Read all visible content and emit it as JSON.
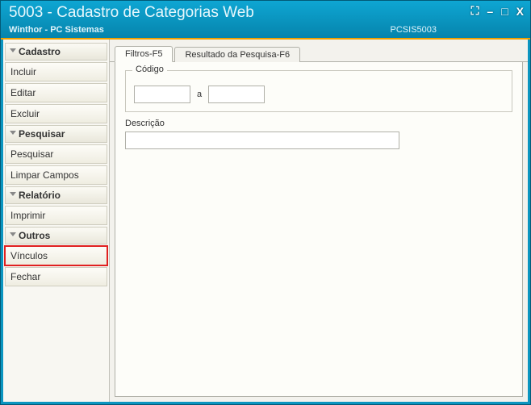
{
  "window": {
    "title": "5003 - Cadastro de Categorias Web",
    "subtitle": "Winthor - PC Sistemas",
    "status_code": "PCSIS5003",
    "controls": {
      "expand": "⛶",
      "minimize": "–",
      "maximize": "□",
      "close": "X"
    }
  },
  "sidebar": {
    "groups": [
      {
        "label": "Cadastro",
        "items": [
          {
            "label": "Incluir",
            "highlight": false
          },
          {
            "label": "Editar",
            "highlight": false
          },
          {
            "label": "Excluir",
            "highlight": false
          }
        ]
      },
      {
        "label": "Pesquisar",
        "items": [
          {
            "label": "Pesquisar",
            "highlight": false
          },
          {
            "label": "Limpar Campos",
            "highlight": false
          }
        ]
      },
      {
        "label": "Relatório",
        "items": [
          {
            "label": "Imprimir",
            "highlight": false
          }
        ]
      },
      {
        "label": "Outros",
        "items": [
          {
            "label": "Vínculos",
            "highlight": true
          },
          {
            "label": "Fechar",
            "highlight": false
          }
        ]
      }
    ]
  },
  "tabs": [
    {
      "label": "Filtros-F5",
      "active": true
    },
    {
      "label": "Resultado da Pesquisa-F6",
      "active": false
    }
  ],
  "filters": {
    "codigo_label": "Código",
    "codigo_from": "",
    "codigo_to_label": "a",
    "codigo_to": "",
    "descricao_label": "Descrição",
    "descricao_value": ""
  }
}
